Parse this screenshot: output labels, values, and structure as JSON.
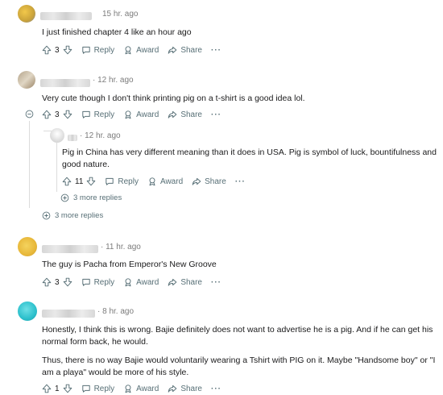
{
  "labels": {
    "reply": "Reply",
    "award": "Award",
    "share": "Share",
    "more": "···"
  },
  "comments": [
    {
      "time": "15 hr. ago",
      "text": "I just finished chapter 4 like an hour ago",
      "votes": "3"
    },
    {
      "time": "· 12 hr. ago",
      "text": "Very cute though I don't think printing pig on a t-shirt is a good idea lol.",
      "votes": "3",
      "more_replies": "3 more replies"
    },
    {
      "time": "· 12 hr. ago",
      "text": "Pig in China has very different meaning than it does in USA. Pig is symbol of luck, bountifulness and good nature.",
      "votes": "11",
      "more_replies": "3 more replies"
    },
    {
      "time": "· 11 hr. ago",
      "text": "The guy is Pacha from Emperor's New Groove",
      "votes": "3"
    },
    {
      "time": "· 8 hr. ago",
      "text1": "Honestly, I think this is wrong. Bajie definitely does not want to advertise he is a pig. And if he can get his normal form back, he would.",
      "text2": "Thus, there is no way Bajie would voluntarily wearing a Tshirt with PIG on it. Maybe \"Handsome boy\" or \"I am a playa\" would be more of his style.",
      "votes": "1"
    }
  ],
  "colors": {
    "meta": "#7c7c7c",
    "action": "#576f76",
    "text": "#1a1a1b",
    "thread": "#dcdcdc"
  }
}
